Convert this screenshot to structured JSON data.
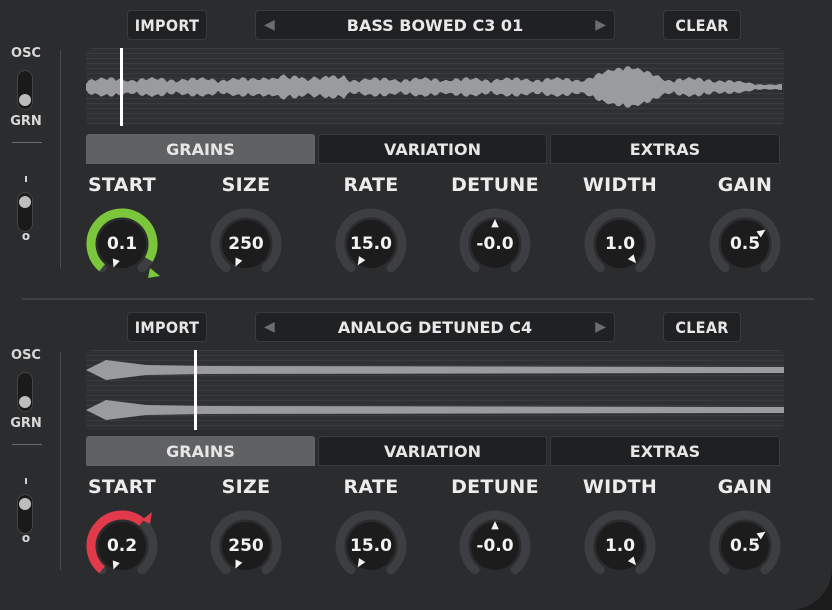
{
  "slots": [
    {
      "import_label": "IMPORT",
      "clear_label": "CLEAR",
      "sample_name": "BASS BOWED C3 01",
      "prev_icon": "triangle-left-icon",
      "next_icon": "triangle-right-icon",
      "mode_top_label": "OSC",
      "mode_bottom_label": "GRN",
      "mode_selected": "GRN",
      "tabs": [
        "GRAINS",
        "VARIATION",
        "EXTRAS"
      ],
      "active_tab": "GRAINS",
      "playhead_fraction": 0.05,
      "knobs": [
        {
          "label": "START",
          "value": "0.1",
          "accent": "#7cc63b",
          "fill": 0.1
        },
        {
          "label": "SIZE",
          "value": "250"
        },
        {
          "label": "RATE",
          "value": "15.0"
        },
        {
          "label": "DETUNE",
          "value": "-0.0"
        },
        {
          "label": "WIDTH",
          "value": "1.0"
        },
        {
          "label": "GAIN",
          "value": "0.5"
        }
      ]
    },
    {
      "import_label": "IMPORT",
      "clear_label": "CLEAR",
      "sample_name": "ANALOG DETUNED C4",
      "prev_icon": "triangle-left-icon",
      "next_icon": "triangle-right-icon",
      "mode_top_label": "OSC",
      "mode_bottom_label": "GRN",
      "mode_selected": "GRN",
      "tabs": [
        "GRAINS",
        "VARIATION",
        "EXTRAS"
      ],
      "active_tab": "GRAINS",
      "playhead_fraction": 0.16,
      "knobs": [
        {
          "label": "START",
          "value": "0.2",
          "accent": "#e23a4b",
          "fill": 0.2
        },
        {
          "label": "SIZE",
          "value": "250"
        },
        {
          "label": "RATE",
          "value": "15.0"
        },
        {
          "label": "DETUNE",
          "value": "-0.0"
        },
        {
          "label": "WIDTH",
          "value": "1.0"
        },
        {
          "label": "GAIN",
          "value": "0.5"
        }
      ]
    }
  ],
  "colors": {
    "panel": "#2b2c2e",
    "knob_track": "#3d3e41",
    "knob_body": "#1c1c1d",
    "waveform": "#9a9b9d"
  }
}
